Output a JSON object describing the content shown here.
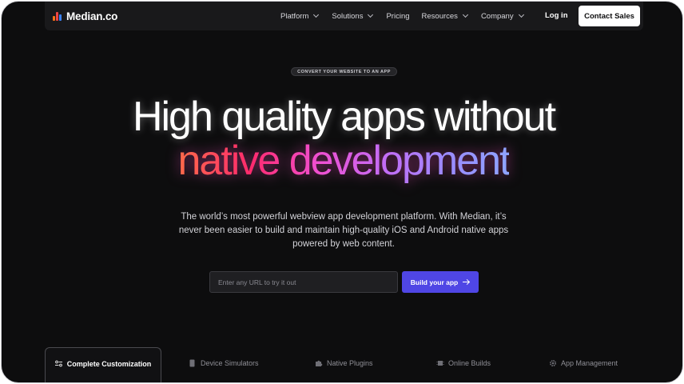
{
  "brand": {
    "name": "Median.co",
    "logo_colors": [
      "#f97316",
      "#ef4444",
      "#3b82f6"
    ]
  },
  "nav": {
    "items": [
      {
        "label": "Platform",
        "dropdown": true
      },
      {
        "label": "Solutions",
        "dropdown": true
      },
      {
        "label": "Pricing",
        "dropdown": false
      },
      {
        "label": "Resources",
        "dropdown": true
      },
      {
        "label": "Company",
        "dropdown": true
      }
    ],
    "login_label": "Log in",
    "cta_label": "Contact Sales"
  },
  "hero": {
    "eyebrow": "CONVERT YOUR WEBSITE TO AN APP",
    "title_line1": "High quality apps without",
    "title_line2": "native development",
    "subtitle": "The world’s most powerful webview app development platform. With Median, it’s never been easier to build and maintain high-quality iOS and Android native apps powered by web content.",
    "url_placeholder": "Enter any URL to try it out",
    "url_value": "",
    "build_label": "Build your app"
  },
  "tabs": [
    {
      "label": "Complete Customization",
      "icon": "sliders-icon",
      "active": true
    },
    {
      "label": "Device Simulators",
      "icon": "phone-icon",
      "active": false
    },
    {
      "label": "Native Plugins",
      "icon": "puzzle-icon",
      "active": false
    },
    {
      "label": "Online Builds",
      "icon": "chip-icon",
      "active": false
    },
    {
      "label": "App Management",
      "icon": "gear-icon",
      "active": false
    }
  ],
  "colors": {
    "background": "#0d0d0e",
    "accent": "#4f46e5",
    "gradient_start": "#ff6a4a",
    "gradient_end": "#8ea4ff"
  }
}
